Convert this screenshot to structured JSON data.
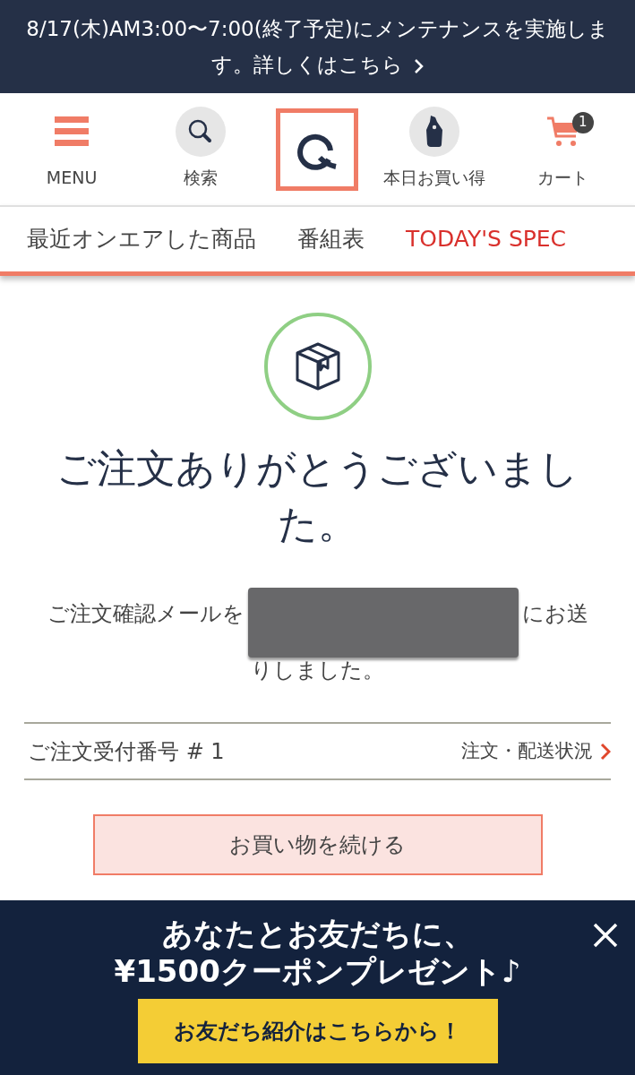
{
  "notice": {
    "text": "8/17(木)AM3:00〜7:00(終了予定)にメンテナンスを実施します。詳しくはこちら"
  },
  "header": {
    "items": [
      {
        "kind": "menu",
        "label": "MENU"
      },
      {
        "kind": "search",
        "label": "検索"
      },
      {
        "kind": "logo"
      },
      {
        "kind": "deals",
        "label": "本日お買い得"
      },
      {
        "kind": "cart",
        "label": "カート",
        "badge": "1"
      }
    ]
  },
  "nav": {
    "tabs": [
      {
        "label": "最近オンエアした商品",
        "kind": "plain"
      },
      {
        "label": "番組表",
        "kind": "plain"
      },
      {
        "label": "TODAY'S SPEC",
        "kind": "featured"
      }
    ]
  },
  "confirmation": {
    "title": "ご注文ありがとうございました。",
    "message_start": "ご注文確認メールを",
    "message_end": "にお送",
    "message_line2": "りしました。"
  },
  "order": {
    "label": "ご注文受付番号 # 1",
    "link": "注文・配送状況"
  },
  "continue_button": "お買い物を続ける",
  "promo": {
    "line1": "あなたとお友だちに、",
    "line2": "¥1500クーポンプレゼント♪",
    "button": "お友だち紹介はこちらから！"
  }
}
